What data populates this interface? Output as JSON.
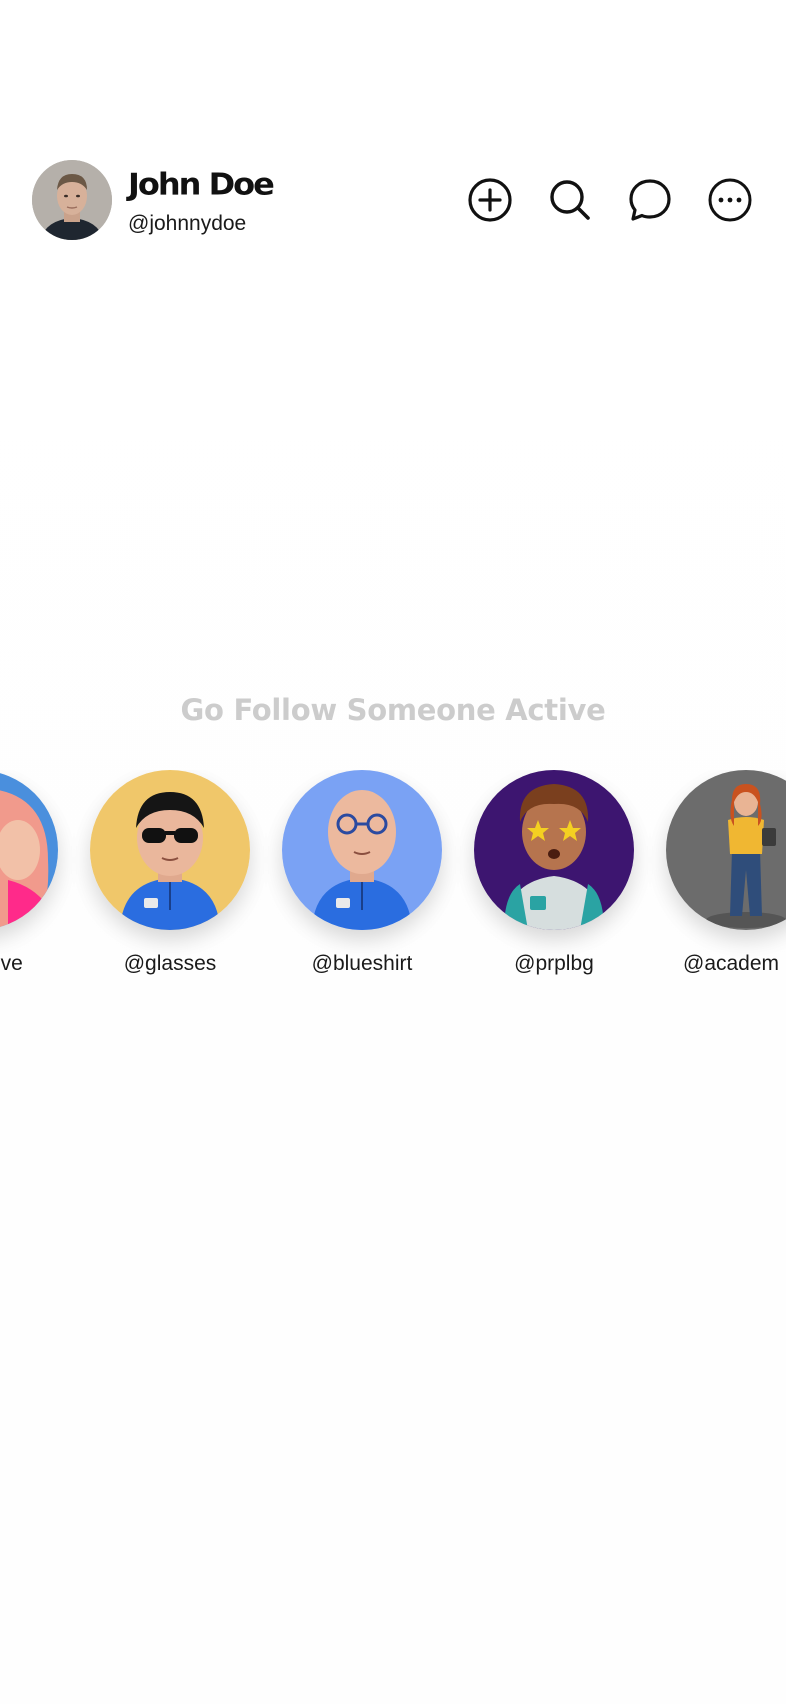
{
  "profile": {
    "name": "John Doe",
    "handle": "@johnnydoe"
  },
  "header_actions": [
    {
      "icon": "plus-circle-icon"
    },
    {
      "icon": "search-icon"
    },
    {
      "icon": "chat-bubble-icon"
    },
    {
      "icon": "more-icon"
    }
  ],
  "follow_section": {
    "title": "Go Follow Someone Active",
    "users": [
      {
        "handle": "@detective",
        "visible_text": "ective",
        "bg_color": "#4a8fdd"
      },
      {
        "handle": "@glasses",
        "visible_text": "@glasses",
        "bg_color": "#f0c76a"
      },
      {
        "handle": "@blueshirt",
        "visible_text": "@blueshirt",
        "bg_color": "#7aa2f4"
      },
      {
        "handle": "@prplbg",
        "visible_text": "@prplbg",
        "bg_color": "#3d1570"
      },
      {
        "handle": "@academ",
        "visible_text": "@academ",
        "bg_color": "#6c6c6c"
      }
    ]
  },
  "colors": {
    "text": "#111111",
    "muted_title": "#cccccc",
    "background": "#ffffff"
  }
}
